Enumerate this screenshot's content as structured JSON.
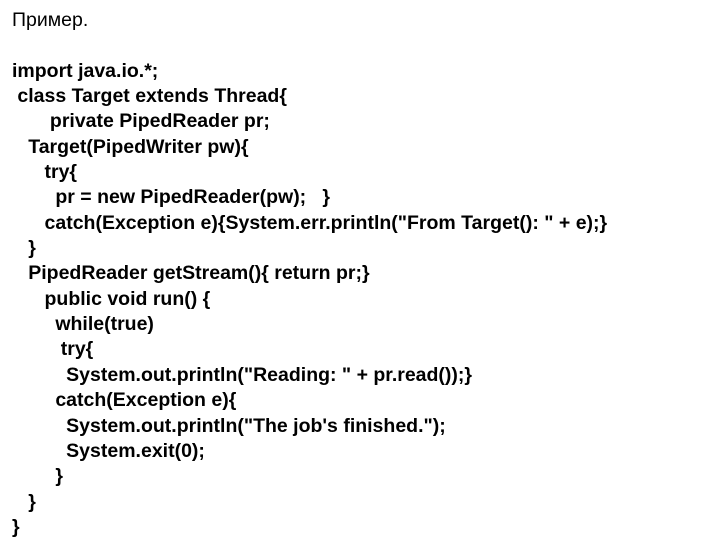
{
  "heading": "Пример.",
  "code": {
    "l01": "import java.io.*;",
    "l02": " class Target extends Thread{",
    "l03": "       private PipedReader pr;",
    "l04": "   Target(PipedWriter pw){",
    "l05": "      try{",
    "l06": "        pr = new PipedReader(pw);   }",
    "l07": "      catch(Exception e){System.err.println(\"From Target(): \" + e);}",
    "l08": "   }",
    "l09": "   PipedReader getStream(){ return pr;}",
    "l10": "      public void run() {",
    "l11": "        while(true)",
    "l12": "         try{",
    "l13": "          System.out.println(\"Reading: \" + pr.read());}",
    "l14": "        catch(Exception e){",
    "l15": "          System.out.println(\"The job's finished.\");",
    "l16": "          System.exit(0);",
    "l17": "        }",
    "l18": "   }",
    "l19": "}"
  }
}
